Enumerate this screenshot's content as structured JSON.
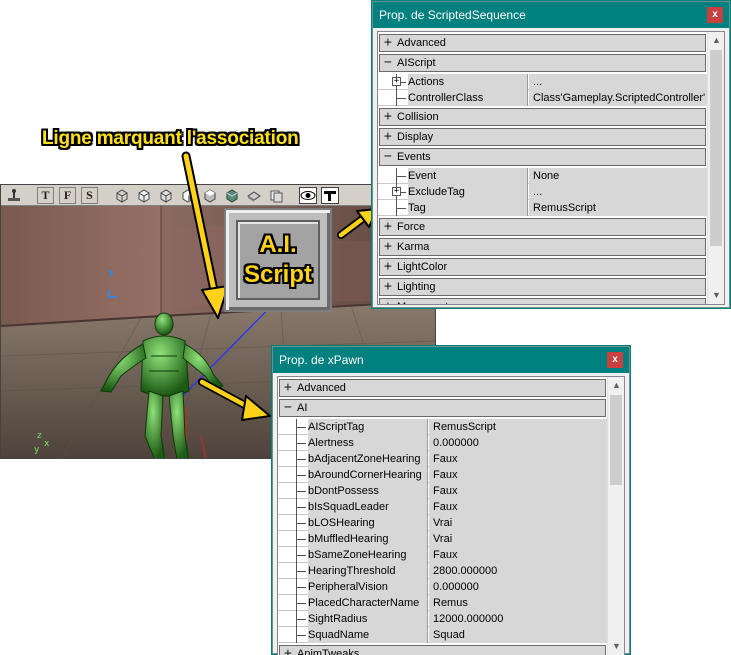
{
  "callout": {
    "label": "Ligne marquant l'association"
  },
  "badge": {
    "line1": "A.I.",
    "line2": "Script"
  },
  "viewport": {
    "toolbar": {
      "btn_t": "T",
      "btn_f": "F",
      "btn_s": "S"
    }
  },
  "scripted_window": {
    "title": "Prop. de ScriptedSequence",
    "close": "x",
    "rows": [
      {
        "kind": "cat",
        "sign": "+",
        "label": "Advanced"
      },
      {
        "kind": "cat",
        "sign": "−",
        "label": "AIScript"
      },
      {
        "kind": "prop",
        "name": "Actions",
        "value": "...",
        "expandable": true
      },
      {
        "kind": "prop",
        "name": "ControllerClass",
        "value": "Class'Gameplay.ScriptedController'"
      },
      {
        "kind": "cat",
        "sign": "+",
        "label": "Collision"
      },
      {
        "kind": "cat",
        "sign": "+",
        "label": "Display"
      },
      {
        "kind": "cat",
        "sign": "−",
        "label": "Events"
      },
      {
        "kind": "prop",
        "name": "Event",
        "value": "None"
      },
      {
        "kind": "prop",
        "name": "ExcludeTag",
        "value": "...",
        "expandable": true
      },
      {
        "kind": "prop",
        "name": "Tag",
        "value": "RemusScript"
      },
      {
        "kind": "cat",
        "sign": "+",
        "label": "Force"
      },
      {
        "kind": "cat",
        "sign": "+",
        "label": "Karma"
      },
      {
        "kind": "cat",
        "sign": "+",
        "label": "LightColor"
      },
      {
        "kind": "cat",
        "sign": "+",
        "label": "Lighting"
      },
      {
        "kind": "cat",
        "sign": "+",
        "label": "Movement"
      }
    ]
  },
  "pawn_window": {
    "title": "Prop. de xPawn",
    "close": "x",
    "rows": [
      {
        "kind": "cat",
        "sign": "+",
        "label": "Advanced"
      },
      {
        "kind": "cat",
        "sign": "−",
        "label": "AI"
      },
      {
        "kind": "prop",
        "name": "AIScriptTag",
        "value": "RemusScript"
      },
      {
        "kind": "prop",
        "name": "Alertness",
        "value": "0.000000"
      },
      {
        "kind": "prop",
        "name": "bAdjacentZoneHearing",
        "value": "Faux"
      },
      {
        "kind": "prop",
        "name": "bAroundCornerHearing",
        "value": "Faux"
      },
      {
        "kind": "prop",
        "name": "bDontPossess",
        "value": "Faux"
      },
      {
        "kind": "prop",
        "name": "bIsSquadLeader",
        "value": "Faux"
      },
      {
        "kind": "prop",
        "name": "bLOSHearing",
        "value": "Vrai"
      },
      {
        "kind": "prop",
        "name": "bMuffledHearing",
        "value": "Vrai"
      },
      {
        "kind": "prop",
        "name": "bSameZoneHearing",
        "value": "Faux"
      },
      {
        "kind": "prop",
        "name": "HearingThreshold",
        "value": "2800.000000"
      },
      {
        "kind": "prop",
        "name": "PeripheralVision",
        "value": "0.000000"
      },
      {
        "kind": "prop",
        "name": "PlacedCharacterName",
        "value": "Remus"
      },
      {
        "kind": "prop",
        "name": "SightRadius",
        "value": "12000.000000"
      },
      {
        "kind": "prop",
        "name": "SquadName",
        "value": "Squad"
      },
      {
        "kind": "cat",
        "sign": "+",
        "label": "AnimTweaks"
      }
    ]
  },
  "colors": {
    "titlebar": "#00807f",
    "callout": "#ffe11a",
    "arrow": "#ffd21a"
  }
}
